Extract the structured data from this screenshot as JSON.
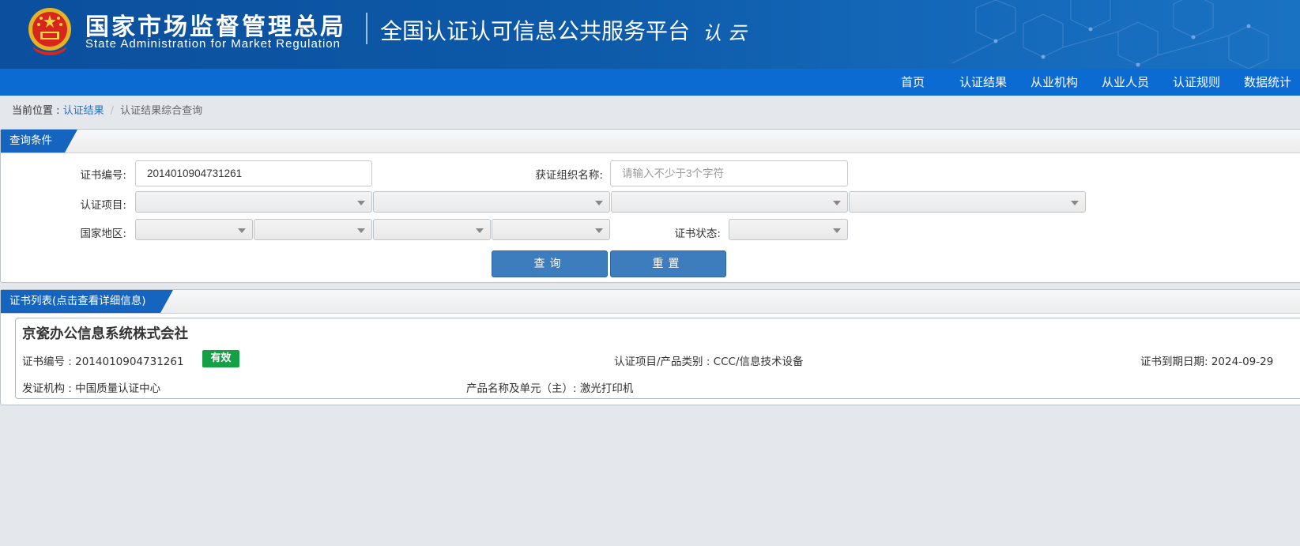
{
  "header": {
    "title_cn": "国家市场监督管理总局",
    "title_en": "State Administration  for  Market Regulation",
    "platform_name": "全国认证认可信息公共服务平台",
    "cloud_logo_text": "认 云"
  },
  "nav": {
    "items": [
      {
        "label": "首页"
      },
      {
        "label": "认证结果"
      },
      {
        "label": "从业机构"
      },
      {
        "label": "从业人员"
      },
      {
        "label": "认证规则"
      },
      {
        "label": "数据统计"
      }
    ]
  },
  "breadcrumb": {
    "prefix": "当前位置 : ",
    "link": "认证结果",
    "separator": "/",
    "current": "认证结果综合查询"
  },
  "query_panel": {
    "title": "查询条件",
    "cert_no_label": "证书编号:",
    "cert_no_value": "2014010904731261",
    "org_name_label": "获证组织名称:",
    "org_name_placeholder": "请输入不少于3个字符",
    "cert_project_label": "认证项目:",
    "region_label": "国家地区:",
    "cert_status_label": "证书状态:",
    "search_button": "查询",
    "reset_button": "重置"
  },
  "list_panel": {
    "title": "证书列表(点击查看详细信息)"
  },
  "results": [
    {
      "org_name": "京瓷办公信息系统株式会社",
      "cert_no_text": "证书编号 : 2014010904731261",
      "status": "有效",
      "project_text": "认证项目/产品类别 : CCC/信息技术设备",
      "expiry_text": "证书到期日期: 2024-09-29",
      "issuer_text": "发证机构 : 中国质量认证中心",
      "product_text": "产品名称及单元（主）: 激光打印机"
    }
  ],
  "colors": {
    "header_bg": "#0d5aa8",
    "nav_bg": "#0c6ad3",
    "tab_bg": "#1565c0",
    "button_bg": "#3d7cbd",
    "status_valid": "#16a045",
    "page_bg": "#e4e8ec"
  },
  "icons": {
    "emblem": "national-emblem-icon",
    "select_caret": "caret-down-icon"
  }
}
